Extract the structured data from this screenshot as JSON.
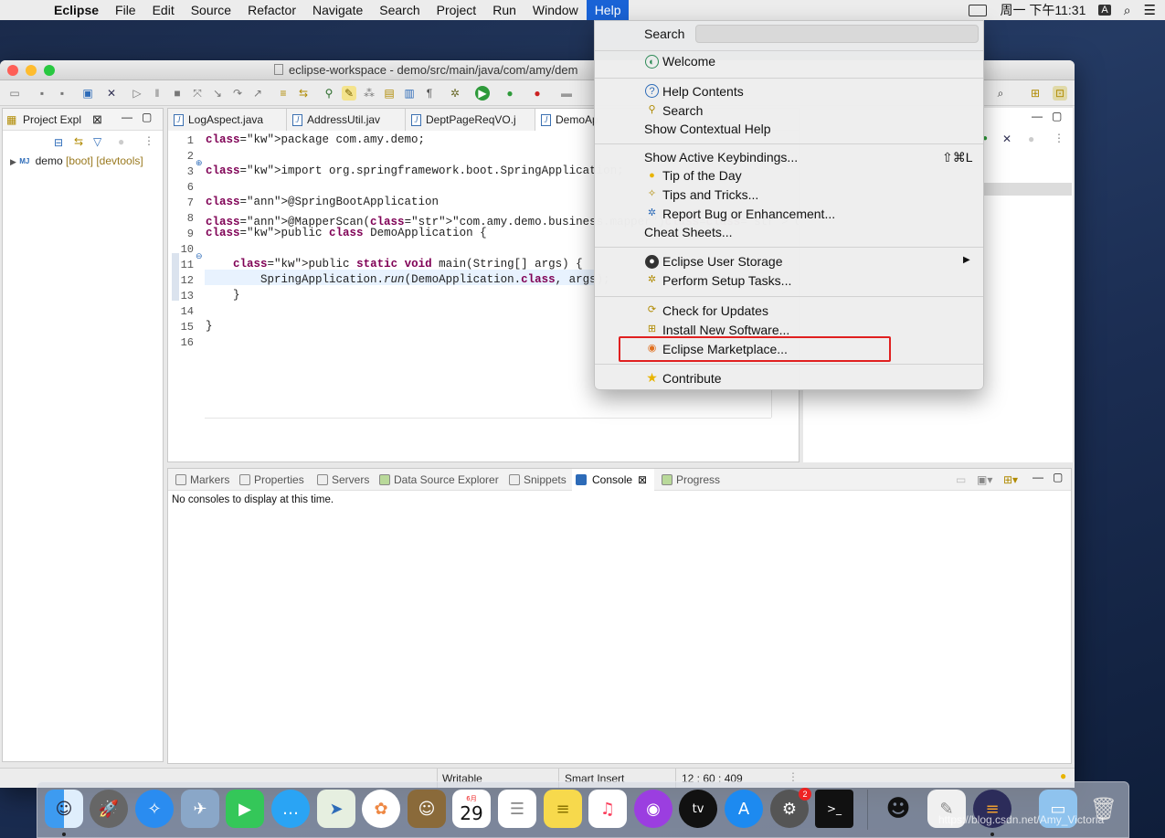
{
  "menubar": {
    "app": "Eclipse",
    "items": [
      "File",
      "Edit",
      "Source",
      "Refactor",
      "Navigate",
      "Search",
      "Project",
      "Run",
      "Window",
      "Help"
    ],
    "clock": "周一 下午11:31",
    "input_source": "A"
  },
  "window": {
    "title": "eclipse-workspace - demo/src/main/java/com/amy/dem"
  },
  "project_explorer": {
    "tab_label": "Project Expl",
    "tree": [
      {
        "name": "demo",
        "decoration": "[boot] [devtools]"
      }
    ]
  },
  "editor": {
    "tabs": [
      "LogAspect.java",
      "AddressUtil.jav",
      "DeptPageReqVO.j",
      "DemoAp"
    ],
    "active_tab_index": 3,
    "line_numbers": [
      "1",
      "2",
      "3",
      "6",
      "7",
      "8",
      "9",
      "10",
      "11",
      "12",
      "13",
      "14",
      "15",
      "16"
    ],
    "lines": [
      {
        "n": "1",
        "text": "package com.amy.demo;"
      },
      {
        "n": "2",
        "text": ""
      },
      {
        "n": "3",
        "text": "import org.springframework.boot.SpringApplication;"
      },
      {
        "n": "6",
        "text": ""
      },
      {
        "n": "7",
        "text": "@SpringBootApplication"
      },
      {
        "n": "8",
        "text": "@MapperScan(\"com.amy.demo.business.mapper\")//tkmybatis的注解"
      },
      {
        "n": "9",
        "text": "public class DemoApplication {"
      },
      {
        "n": "10",
        "text": ""
      },
      {
        "n": "11",
        "text": "    public static void main(String[] args) {"
      },
      {
        "n": "12",
        "text": "        SpringApplication.run(DemoApplication.class, args);"
      },
      {
        "n": "13",
        "text": "    }"
      },
      {
        "n": "14",
        "text": ""
      },
      {
        "n": "15",
        "text": "}"
      },
      {
        "n": "16",
        "text": ""
      }
    ]
  },
  "console": {
    "tabs": [
      "Markers",
      "Properties",
      "Servers",
      "Data Source Explorer",
      "Snippets",
      "Console",
      "Progress"
    ],
    "active_tab": "Console",
    "message": "No consoles to display at this time."
  },
  "status_bar": {
    "mode": "Writable",
    "insert": "Smart Insert",
    "position": "12 : 60 : 409"
  },
  "help_menu": {
    "search_label": "Search",
    "search_value": "",
    "items": {
      "welcome": "Welcome",
      "help_contents": "Help Contents",
      "search": "Search",
      "contextual_help": "Show Contextual Help",
      "keybindings": "Show Active Keybindings...",
      "keybindings_shortcut": "⇧⌘L",
      "tip_of_day": "Tip of the Day",
      "tips_tricks": "Tips and Tricks...",
      "report_bug": "Report Bug or Enhancement...",
      "cheat_sheets": "Cheat Sheets...",
      "user_storage": "Eclipse User Storage",
      "setup_tasks": "Perform Setup Tasks...",
      "check_updates": "Check for Updates",
      "install_software": "Install New Software...",
      "marketplace": "Eclipse Marketplace...",
      "contribute": "Contribute"
    },
    "highlight_color": "#e02020"
  },
  "dock": {
    "calendar_month": "6月",
    "calendar_day": "29",
    "settings_badge": "2",
    "watermark": "https://blog.csdn.net/Amy_Victoria"
  },
  "colors": {
    "menubar_active": "#1a63d6",
    "keyword": "#7f0055",
    "string": "#2a00ff"
  }
}
